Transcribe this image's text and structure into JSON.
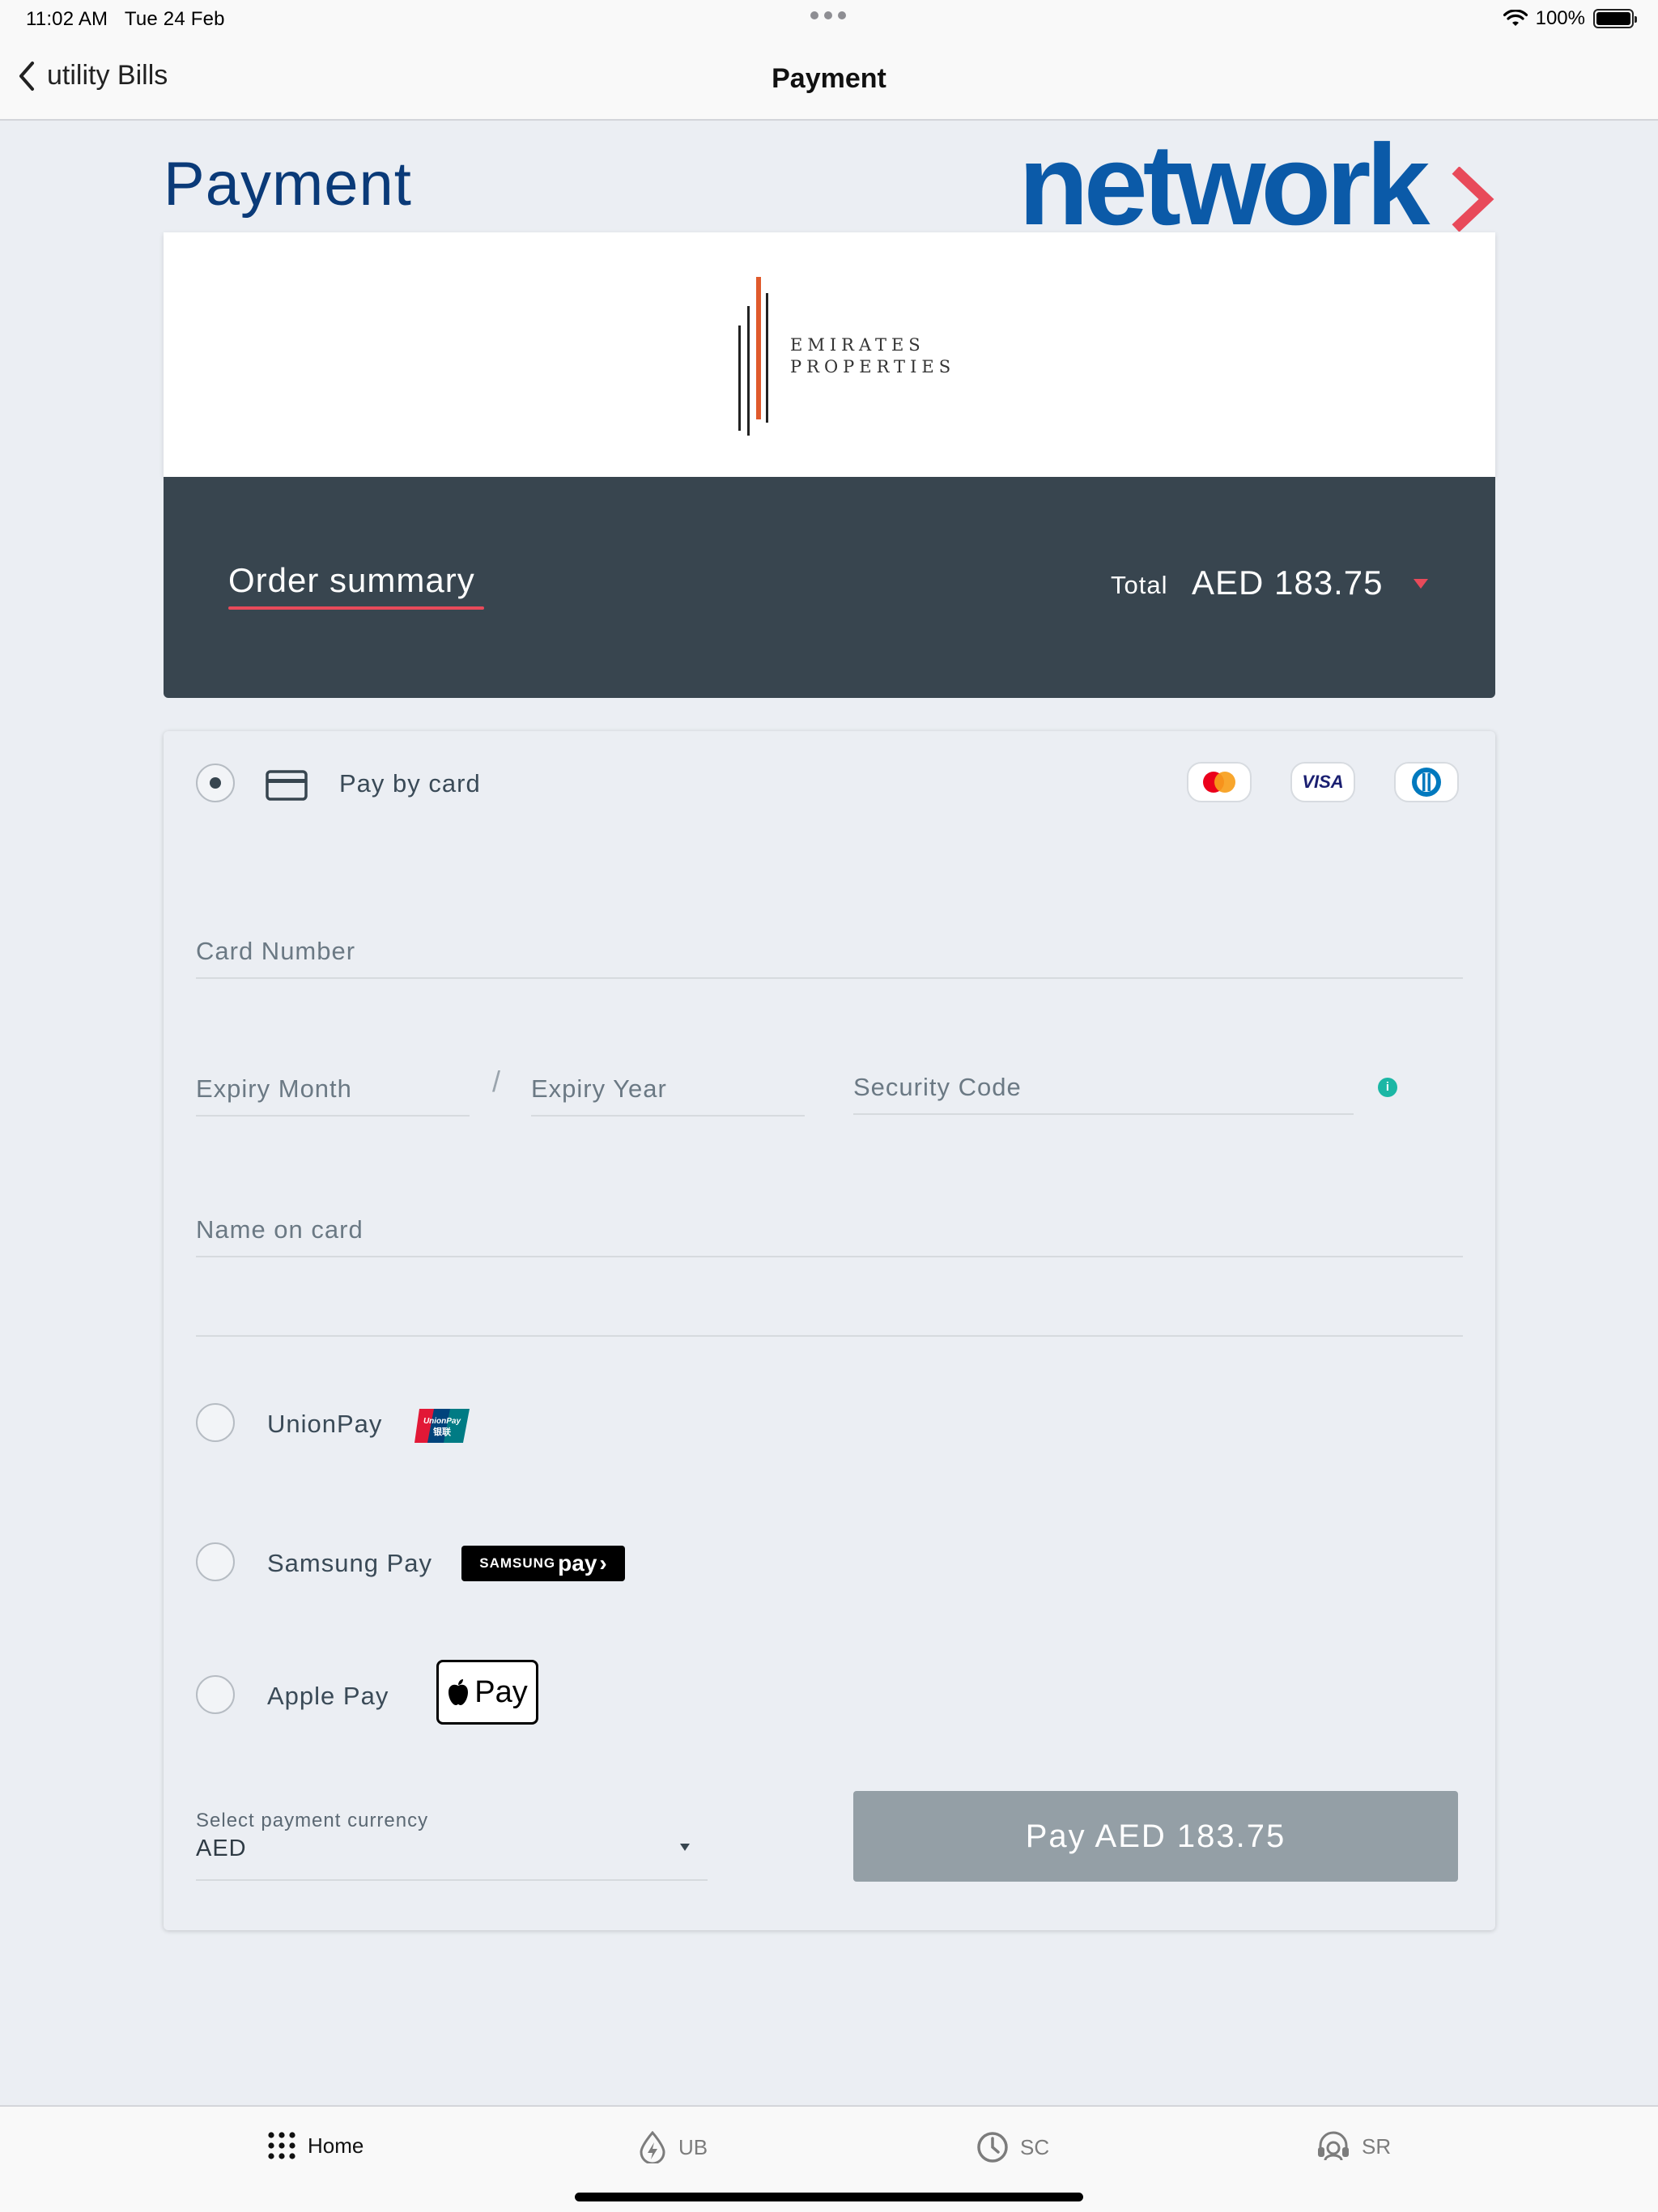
{
  "status_bar": {
    "time": "11:02 AM",
    "date": "Tue 24 Feb",
    "battery": "100%"
  },
  "nav": {
    "back_label": "utility Bills",
    "title": "Payment"
  },
  "page": {
    "heading": "Payment",
    "brand": "network"
  },
  "merchant": {
    "name_line1": "EMIRATES",
    "name_line2": "PROPERTIES"
  },
  "order_summary": {
    "label": "Order summary",
    "total_label": "Total",
    "total_value": "AED 183.75"
  },
  "payment": {
    "card_option": {
      "label": "Pay by card",
      "selected": true,
      "brands": [
        "mastercard-icon",
        "visa-icon",
        "diners-icon"
      ],
      "visa_text": "VISA"
    },
    "fields": {
      "card_number": "Card Number",
      "expiry_month": "Expiry Month",
      "expiry_separator": "/",
      "expiry_year": "Expiry Year",
      "security_code": "Security Code",
      "info_mark": "i",
      "name_on_card": "Name on card"
    },
    "unionpay": {
      "label": "UnionPay",
      "badge_top": "UnionPay",
      "badge_bottom": "银联"
    },
    "samsung_pay": {
      "label": "Samsung Pay",
      "badge_a": "SAMSUNG",
      "badge_b": "pay",
      "badge_arrow": "›"
    },
    "apple_pay": {
      "label": "Apple Pay",
      "badge_text": "Pay"
    },
    "currency": {
      "caption": "Select payment currency",
      "value": "AED"
    },
    "pay_button": "Pay  AED 183.75"
  },
  "tabs": [
    {
      "label": "Home",
      "icon": "grid-icon",
      "active": true
    },
    {
      "label": "UB",
      "icon": "bolt-drop-icon",
      "active": false
    },
    {
      "label": "SC",
      "icon": "clock-icon",
      "active": false
    },
    {
      "label": "SR",
      "icon": "headset-icon",
      "active": false
    }
  ],
  "colors": {
    "brand_blue": "#0b5aa8",
    "heading_blue": "#0a3a78",
    "accent_red": "#e84a5a",
    "summary_bg": "#38454f",
    "button_gray": "#949fa6",
    "info_teal": "#1bb7a5"
  }
}
